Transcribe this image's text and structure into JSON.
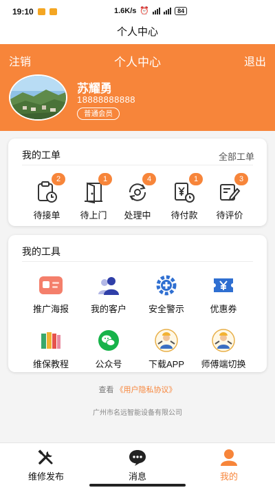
{
  "status_bar": {
    "time": "19:10",
    "network_speed": "1.6K/s",
    "battery": "84"
  },
  "title_bar": {
    "title": "个人中心"
  },
  "header": {
    "left_action": "注销",
    "title": "个人中心",
    "right_action": "退出",
    "user_name": "苏耀勇",
    "phone": "18888888888",
    "member_level": "普通会员"
  },
  "orders": {
    "title": "我的工单",
    "view_all": "全部工单",
    "items": [
      {
        "label": "待接单",
        "count": "2",
        "icon": "clipboard-clock-icon"
      },
      {
        "label": "待上门",
        "count": "1",
        "icon": "door-icon"
      },
      {
        "label": "处理中",
        "count": "4",
        "icon": "gear-refresh-icon"
      },
      {
        "label": "待付款",
        "count": "1",
        "icon": "invoice-yen-icon"
      },
      {
        "label": "待评价",
        "count": "3",
        "icon": "edit-note-icon"
      }
    ]
  },
  "tools": {
    "title": "我的工具",
    "items": [
      {
        "label": "推广海报",
        "icon": "id-card-icon"
      },
      {
        "label": "我的客户",
        "icon": "customers-icon"
      },
      {
        "label": "安全警示",
        "icon": "safety-gear-icon"
      },
      {
        "label": "优惠券",
        "icon": "coupon-yen-icon"
      },
      {
        "label": "维保教程",
        "icon": "books-icon"
      },
      {
        "label": "公众号",
        "icon": "wechat-icon"
      },
      {
        "label": "下载APP",
        "icon": "worker-avatar-icon"
      },
      {
        "label": "师傅端切换",
        "icon": "worker-avatar-icon"
      }
    ]
  },
  "footer": {
    "agreement_prefix": "查看",
    "agreement_link": "《用户隐私协议》",
    "company": "广州市名远智能设备有限公司"
  },
  "tab_bar": {
    "items": [
      {
        "label": "维修发布",
        "icon": "tools-icon",
        "active": false
      },
      {
        "label": "消息",
        "icon": "message-icon",
        "active": false
      },
      {
        "label": "我的",
        "icon": "user-icon",
        "active": true
      }
    ]
  },
  "colors": {
    "accent": "#f7853a",
    "background": "#f4f4f4"
  }
}
